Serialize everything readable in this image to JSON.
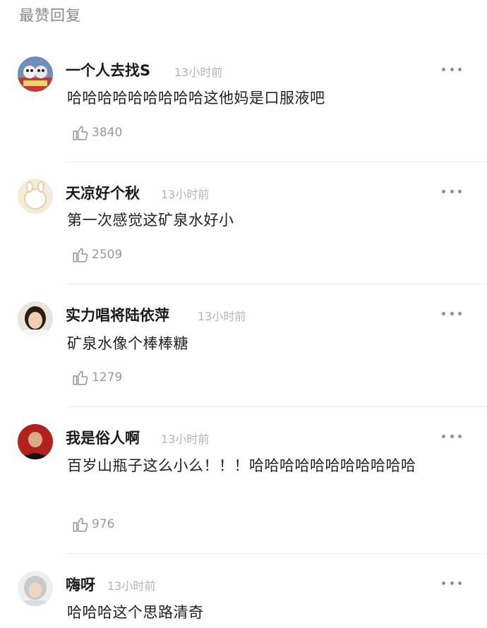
{
  "section_title": "最赞回复",
  "colors": {
    "username": "#1a1a1a",
    "meta": "#b3b3b3",
    "text": "#222222",
    "divider": "#ececec"
  },
  "comments": [
    {
      "username": "一个人去找S",
      "time": "13小时前",
      "text": "哈哈哈哈哈哈哈哈哈这他妈是口服液吧",
      "likes": "3840",
      "avatar_icon": "cartoon-avatar-icon"
    },
    {
      "username": "天凉好个秋",
      "time": "13小时前",
      "text": "第一次感觉这矿泉水好小",
      "likes": "2509",
      "avatar_icon": "beige-cartoon-avatar-icon"
    },
    {
      "username": "实力唱将陆依萍",
      "time": "13小时前",
      "text": "矿泉水像个棒棒糖",
      "likes": "1279",
      "avatar_icon": "woman-portrait-avatar-icon"
    },
    {
      "username": "我是俗人啊",
      "time": "13小时前",
      "text": "百岁山瓶子这么小么！！！哈哈哈哈哈哈哈哈哈哈哈",
      "likes": "976",
      "avatar_icon": "man-portrait-avatar-icon"
    },
    {
      "username": "嗨呀",
      "time": "13小时前",
      "text": "哈哈哈这个思路清奇",
      "likes": "",
      "avatar_icon": "gray-hair-portrait-avatar-icon"
    }
  ]
}
